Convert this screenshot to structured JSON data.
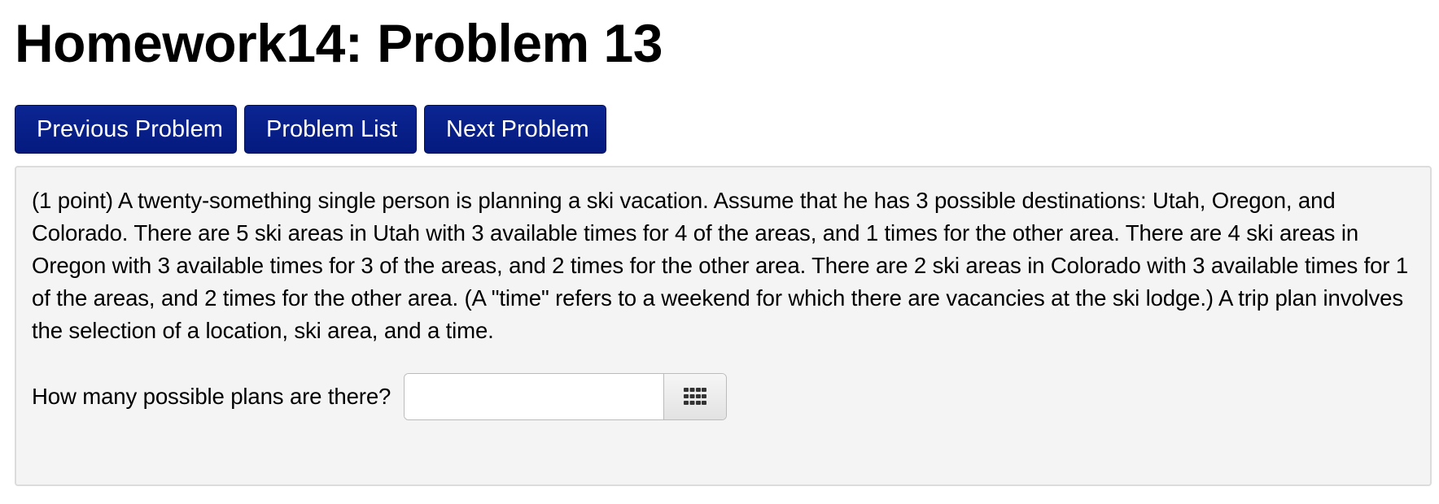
{
  "page": {
    "title": "Homework14: Problem 13"
  },
  "nav": {
    "previous_label": "Previous Problem",
    "list_label": "Problem List",
    "next_label": "Next Problem"
  },
  "problem": {
    "text": "(1 point) A twenty-something single person is planning a ski vacation. Assume that he has 3 possible destinations: Utah, Oregon, and Colorado. There are 5 ski areas in Utah with 3 available times for 4 of the areas, and 1 times for the other area. There are 4 ski areas in Oregon with 3 available times for 3 of the areas, and 2 times for the other area. There are 2 ski areas in Colorado with 3 available times for 1 of the areas, and 2 times for the other area. (A \"time\" refers to a weekend for which there are vacancies at the ski lodge.) A trip plan involves the selection of a location, ski area, and a time.",
    "question": "How many possible plans are there?",
    "answer_value": "",
    "keypad_icon": "keypad-grid-icon"
  },
  "colors": {
    "button_bg": "#041a7f",
    "button_text": "#ffffff",
    "panel_bg": "#f4f4f4",
    "panel_border": "#dcdcdc"
  }
}
